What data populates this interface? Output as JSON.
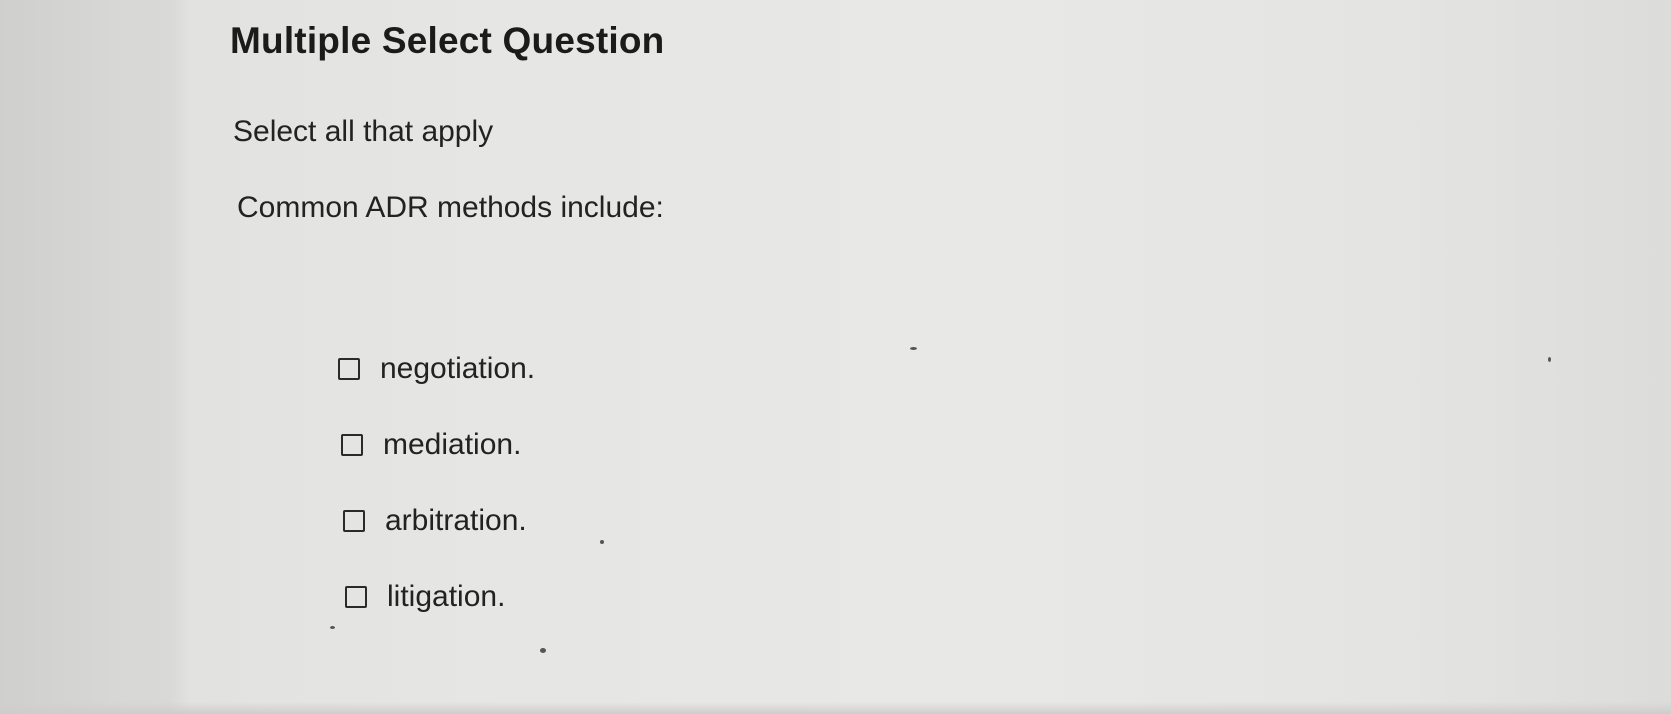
{
  "question": {
    "title": "Multiple Select Question",
    "instruction": "Select all that apply",
    "prompt": "Common ADR methods include:"
  },
  "options": [
    {
      "label": "negotiation.",
      "checked": false
    },
    {
      "label": "mediation.",
      "checked": false
    },
    {
      "label": "arbitration.",
      "checked": false
    },
    {
      "label": "litigation.",
      "checked": false
    }
  ],
  "colors": {
    "text": "#222222",
    "checkbox_border": "#2a2a2a",
    "background": "#e6e6e4"
  }
}
